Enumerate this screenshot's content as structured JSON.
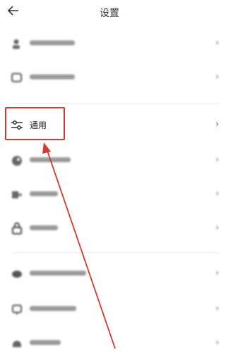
{
  "header": {
    "title": "设置",
    "back_icon": "arrow-left-icon"
  },
  "items": [
    {
      "label": "",
      "icon": "user-icon",
      "blurred": true
    },
    {
      "label": "",
      "icon": "chat-icon",
      "blurred": true
    },
    {
      "label": "通用",
      "icon": "sliders-icon",
      "blurred": false,
      "highlighted": true
    },
    {
      "label": "",
      "icon": "palette-icon",
      "blurred": true
    },
    {
      "label": "",
      "icon": "device-icon",
      "blurred": true
    },
    {
      "label": "",
      "icon": "lock-icon",
      "blurred": true
    },
    {
      "label": "",
      "icon": "cloud-icon",
      "blurred": true
    },
    {
      "label": "",
      "icon": "shield-icon",
      "blurred": true
    },
    {
      "label": "",
      "icon": "help-icon",
      "blurred": true
    }
  ],
  "chevron": "›",
  "colors": {
    "highlight": "#d23a32",
    "text": "#222222"
  }
}
